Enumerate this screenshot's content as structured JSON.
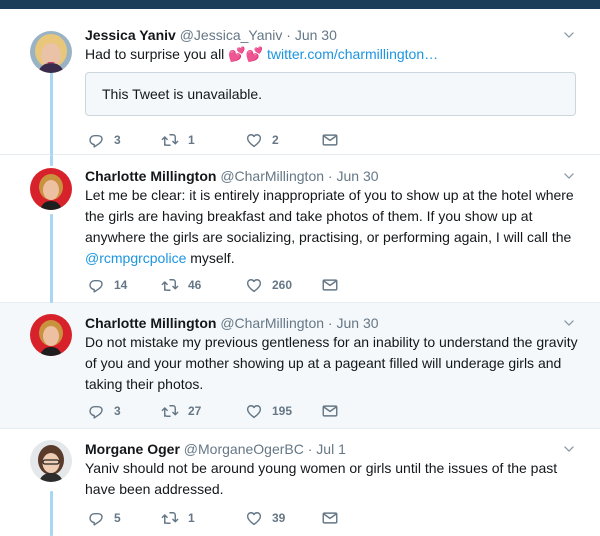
{
  "tweets": [
    {
      "name": "Jessica Yaniv",
      "handle": "@Jessica_Yaniv",
      "date": "Jun 30",
      "text_before": "Had to surprise you all ",
      "emoji": "💕💕",
      "link": "twitter.com/charmillington…",
      "quote": "This Tweet is unavailable.",
      "replies": "3",
      "retweets": "1",
      "likes": "2"
    },
    {
      "name": "Charlotte Millington",
      "handle": "@CharMillington",
      "date": "Jun 30",
      "text": "Let me be clear: it is entirely inappropriate of you to show up at the hotel where the girls are having breakfast and take photos of them. If you show up at anywhere the girls are socializing, practising, or performing again, I will call the ",
      "mention": "@rcmpgrcpolice",
      "text_after": " myself.",
      "replies": "14",
      "retweets": "46",
      "likes": "260"
    },
    {
      "name": "Charlotte Millington",
      "handle": "@CharMillington",
      "date": "Jun 30",
      "text": "Do not mistake my previous gentleness for an inability to understand the gravity of you and your mother showing up at a pageant filled will underage girls and taking their photos.",
      "replies": "3",
      "retweets": "27",
      "likes": "195"
    },
    {
      "name": "Morgane Oger",
      "handle": "@MorganeOgerBC",
      "date": "Jul 1",
      "text": "Yaniv should not be around young women or girls until the issues of the past have been addressed.",
      "replies": "5",
      "retweets": "1",
      "likes": "39"
    }
  ],
  "separator": " · ",
  "icons": {
    "reply": "reply-icon",
    "retweet": "retweet-icon",
    "like": "heart-icon",
    "message": "envelope-icon",
    "caret": "chevron-down-icon"
  },
  "colors": {
    "topbar": "#1b3d5a",
    "link": "#1b95e0",
    "thread_line": "#a9d6f2",
    "muted": "#657786",
    "highlight_bg": "#f5f8fa"
  }
}
